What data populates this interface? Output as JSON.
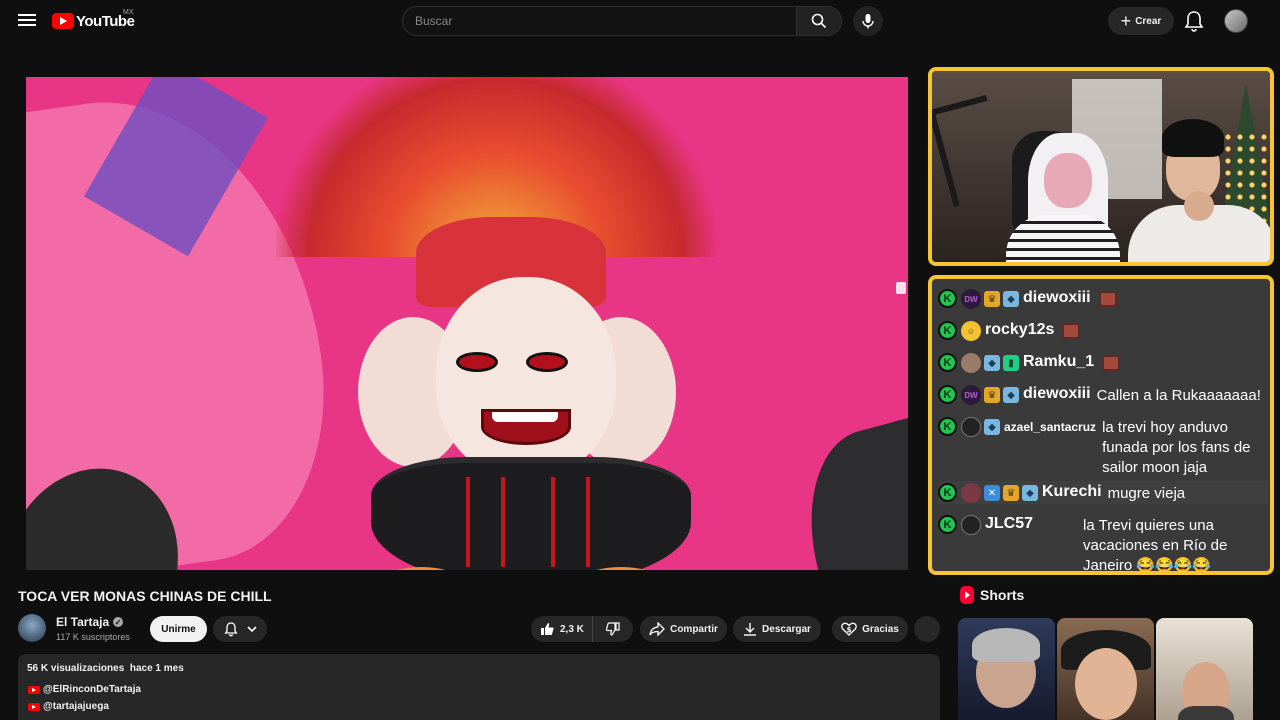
{
  "header": {
    "logo_text": "YouTube",
    "country_code": "MX",
    "search_placeholder": "Buscar",
    "create_label": "Crear"
  },
  "video": {
    "title": "TOCA VER MONAS CHINAS DE CHILL"
  },
  "channel": {
    "name": "El Tartaja",
    "subscribers": "117 K suscriptores",
    "join_label": "Unirme"
  },
  "actions": {
    "likes": "2,3 K",
    "share_label": "Compartir",
    "download_label": "Descargar",
    "thanks_label": "Gracias"
  },
  "description": {
    "views": "56 K visualizaciones",
    "date": "hace 1 mes",
    "links": [
      "@ElRinconDeTartaja",
      "@tartajajuega"
    ]
  },
  "chat": {
    "messages": [
      {
        "user": "diewoxiii",
        "text": ""
      },
      {
        "user": "rocky12s",
        "text": ""
      },
      {
        "user": "Ramku_1",
        "text": ""
      },
      {
        "user": "diewoxiii",
        "text": "Callen a la Rukaaaaaaa!"
      },
      {
        "user": "azael_santacruz",
        "text": "la trevi hoy anduvo funada por los fans de sailor moon jaja"
      },
      {
        "user": "Kurechi",
        "text": "mugre vieja"
      },
      {
        "user": "JLC57",
        "text": "la Trevi quieres una vacaciones en Río de Janeiro 😂😂😂😂"
      }
    ],
    "badge_letter": "K"
  },
  "shorts": {
    "title": "Shorts"
  },
  "colors": {
    "accent": "#ff0000",
    "overlay_border": "#f7c531",
    "kick_green": "#23c552"
  }
}
